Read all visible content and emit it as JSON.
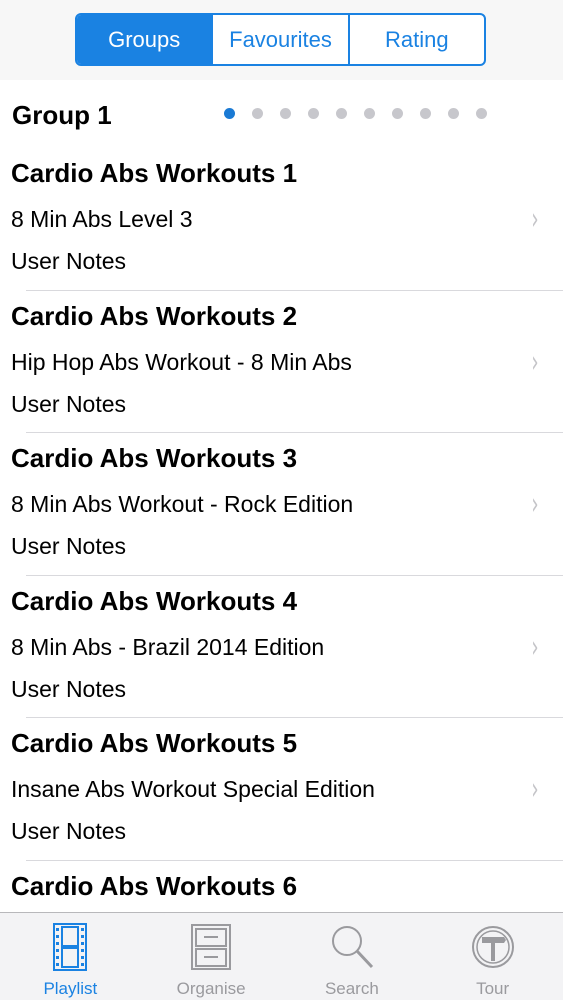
{
  "segments": [
    {
      "label": "Groups",
      "active": true
    },
    {
      "label": "Favourites",
      "active": false
    },
    {
      "label": "Rating",
      "active": false
    }
  ],
  "group": {
    "title": "Group 1",
    "page_count": 10,
    "current_page": 1
  },
  "playlist": [
    {
      "title": "Cardio Abs Workouts 1",
      "subtitle": "8 Min Abs  Level 3",
      "notes": "User Notes"
    },
    {
      "title": "Cardio Abs Workouts 2",
      "subtitle": "Hip Hop Abs  Workout - 8 Min Abs",
      "notes": "User Notes"
    },
    {
      "title": "Cardio Abs Workouts 3",
      "subtitle": "8 Min Abs Workout - Rock Edition",
      "notes": "User Notes"
    },
    {
      "title": "Cardio Abs Workouts 4",
      "subtitle": "8 Min Abs - Brazil 2014 Edition",
      "notes": "User Notes"
    },
    {
      "title": "Cardio Abs Workouts 5",
      "subtitle": "Insane Abs Workout Special Edition",
      "notes": "User Notes"
    },
    {
      "title": "Cardio Abs Workouts 6",
      "subtitle": "",
      "notes": ""
    }
  ],
  "tabs": [
    {
      "label": "Playlist",
      "icon": "film-strip-icon",
      "active": true
    },
    {
      "label": "Organise",
      "icon": "cabinet-icon",
      "active": false
    },
    {
      "label": "Search",
      "icon": "magnifier-icon",
      "active": false
    },
    {
      "label": "Tour",
      "icon": "signpost-icon",
      "active": false
    }
  ],
  "colors": {
    "accent": "#1a82e2",
    "inactive_tab": "#9a9a9e",
    "chevron": "#c4c4c8"
  }
}
